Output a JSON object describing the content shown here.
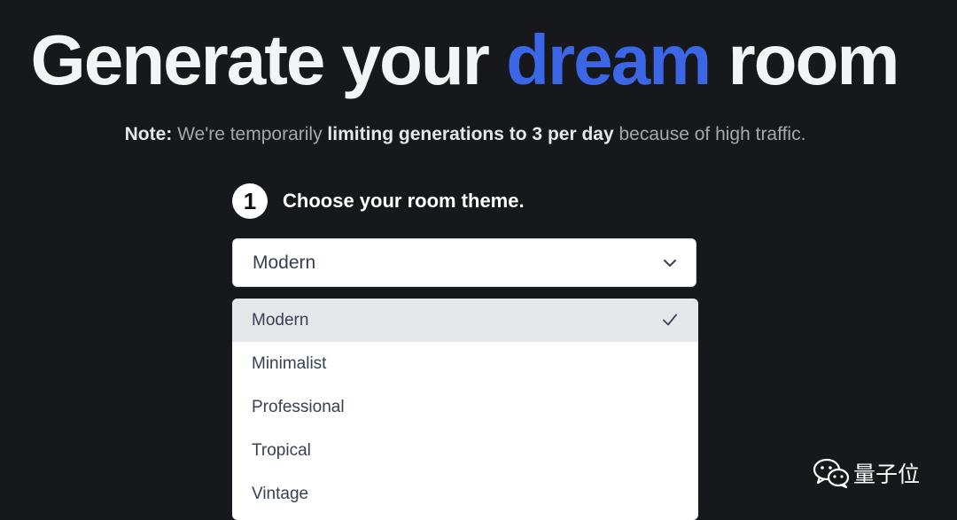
{
  "hero": {
    "title_before": "Generate your ",
    "title_accent": "dream",
    "title_after": " room",
    "accent_color": "#3b66e6"
  },
  "note": {
    "prefix": "Note:",
    "text1": " We're temporarily ",
    "emphasis": "limiting generations to 3 per day",
    "text2": " because of high traffic."
  },
  "step": {
    "number": "1",
    "label": "Choose your room theme."
  },
  "theme_select": {
    "value": "Modern",
    "icon": "chevron-down-icon"
  },
  "theme_options": [
    {
      "label": "Modern",
      "selected": true
    },
    {
      "label": "Minimalist",
      "selected": false
    },
    {
      "label": "Professional",
      "selected": false
    },
    {
      "label": "Tropical",
      "selected": false
    },
    {
      "label": "Vintage",
      "selected": false
    }
  ],
  "watermark": {
    "text": "量子位",
    "icon": "wechat-icon"
  },
  "colors": {
    "background": "#17181c",
    "selected_option_bg": "#e6e7eb"
  }
}
